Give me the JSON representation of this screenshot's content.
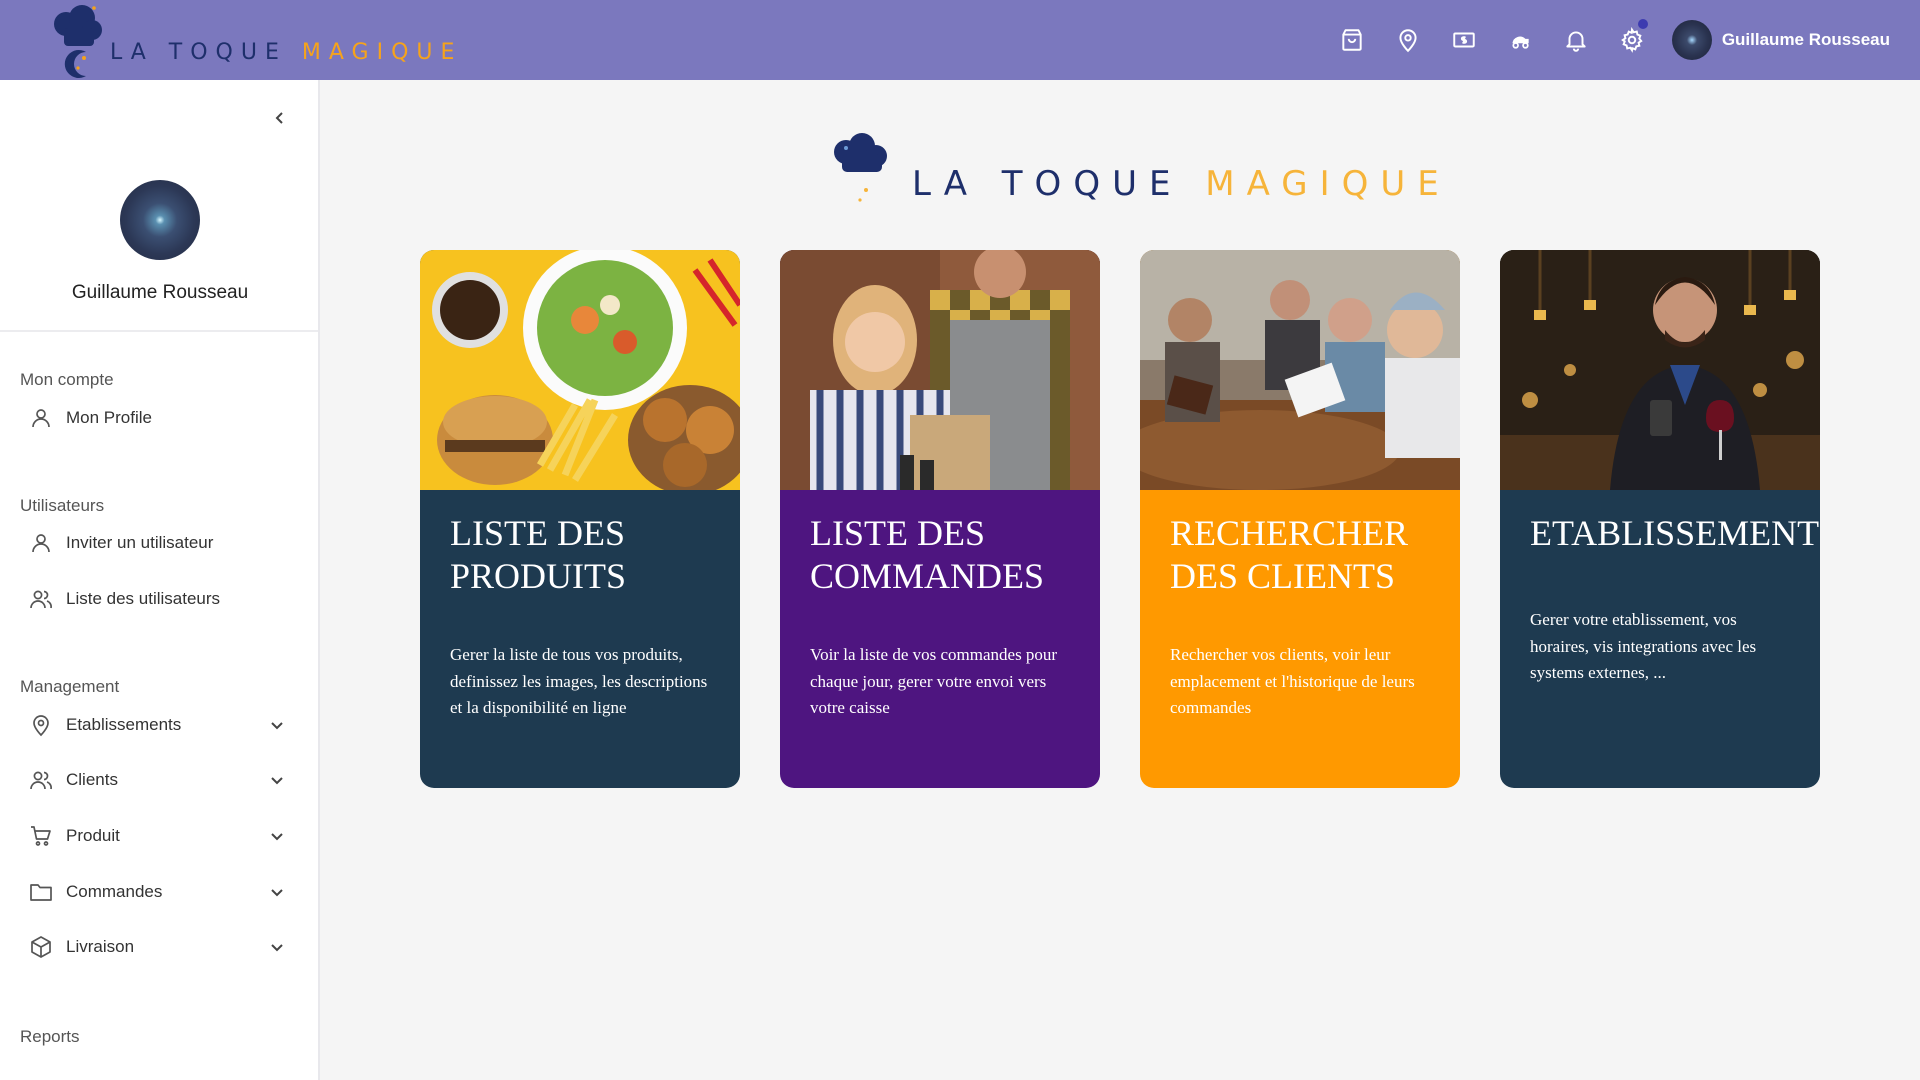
{
  "brand": {
    "word1": "LA TOQUE",
    "word2": "MAGIQUE"
  },
  "topbar": {
    "icons": [
      "shopping-bag-icon",
      "location-pin-icon",
      "cash-icon",
      "delivery-scooter-icon",
      "bell-icon",
      "gear-icon"
    ],
    "user_name": "Guillaume Rousseau"
  },
  "sidebar": {
    "user_name": "Guillaume Rousseau",
    "sections": {
      "account": "Mon compte",
      "users": "Utilisateurs",
      "management": "Management",
      "reports": "Reports"
    },
    "items": {
      "profile": "Mon Profile",
      "invite": "Inviter un utilisateur",
      "users_list": "Liste des utilisateurs",
      "establishments": "Etablissements",
      "clients": "Clients",
      "product": "Produit",
      "orders": "Commandes",
      "delivery": "Livraison"
    }
  },
  "cards": [
    {
      "title": "LISTE DES PRODUITS",
      "description": "Gerer la liste de tous vos produits, definissez les images, les descriptions et la disponibilité en ligne",
      "color": "#1e3a50"
    },
    {
      "title": "LISTE DES COMMANDES",
      "description": "Voir la liste de vos commandes pour chaque jour, gerer votre envoi vers votre caisse",
      "color": "#4e1580"
    },
    {
      "title": "RECHERCHER DES CLIENTS",
      "description": "Rechercher vos clients, voir leur emplacement et l'historique de leurs commandes",
      "color": "#ff9900"
    },
    {
      "title": "ETABLISSEMENT",
      "description": "Gerer votre etablissement, vos horaires, vis integrations avec les systems externes, ...",
      "color": "#1e3a50"
    }
  ],
  "colors": {
    "topbar": "#7b78be",
    "brand_dark": "#1e2f6b",
    "brand_gold": "#f6a31b"
  }
}
